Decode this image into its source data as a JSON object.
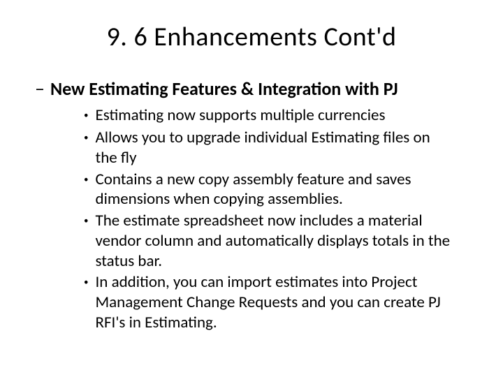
{
  "title": "9. 6 Enhancements Cont'd",
  "subheading_dash": "–",
  "subheading": "New Estimating Features & Integration with PJ",
  "bullets": [
    "Estimating now supports multiple currencies",
    "Allows you to upgrade individual Estimating files on the fly",
    "Contains a new copy assembly feature and saves dimensions when copying assemblies.",
    "The estimate spreadsheet now includes a material vendor column and automatically displays totals in the status bar.",
    "In addition, you can import estimates into Project Management Change Requests and you can create PJ RFI's in Estimating."
  ]
}
